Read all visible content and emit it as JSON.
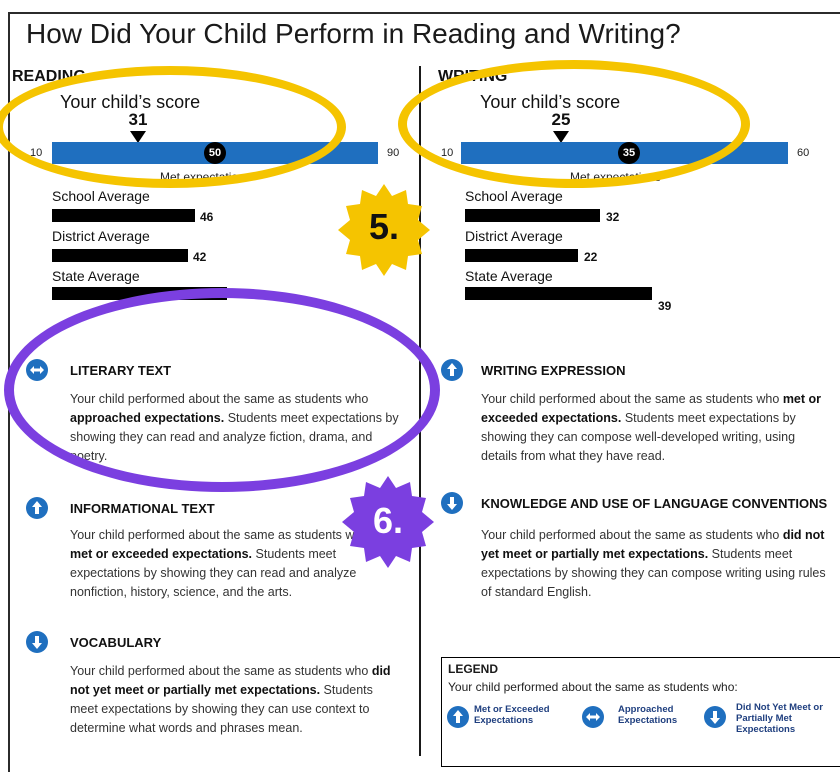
{
  "page": {
    "title": "How Did Your Child Perform in Reading and Writing?"
  },
  "reading": {
    "heading": "READING",
    "score_caption": "Your child’s score",
    "score": 31,
    "score_min": 10,
    "score_max": 90,
    "met_value": 50,
    "met_label": "Met expectations",
    "averages": [
      {
        "label": "School Average",
        "value": 46
      },
      {
        "label": "District Average",
        "value": 42
      },
      {
        "label": "State Average",
        "value": ""
      }
    ],
    "categories": [
      {
        "title": "LITERARY TEXT",
        "icon": "two-way-arrow-icon",
        "text_before": "Your child performed about the same as students who ",
        "text_bold": "approached expectations.",
        "text_after": " Students meet expectations by showing they can read and analyze fiction, drama, and poetry."
      },
      {
        "title": "INFORMATIONAL TEXT",
        "icon": "up-arrow-icon",
        "text_before": "Your child performed about the same as students who ",
        "text_bold": "met or exceeded expectations.",
        "text_after": " Students meet expectations by showing they can read and analyze nonfiction, history, science, and the arts."
      },
      {
        "title": "VOCABULARY",
        "icon": "down-arrow-icon",
        "text_before": "Your child performed about the same as students who ",
        "text_bold": "did not yet meet or partially met expectations.",
        "text_after": " Students meet expectations by showing they can use context to determine what words and phrases mean."
      }
    ]
  },
  "writing": {
    "heading": "WRITING",
    "score_caption": "Your child’s score",
    "score": 25,
    "score_min": 10,
    "score_max": 60,
    "met_value": 35,
    "met_label": "Met expectations",
    "averages": [
      {
        "label": "School Average",
        "value": 32
      },
      {
        "label": "District Average",
        "value": 22
      },
      {
        "label": "State Average",
        "value": 39
      }
    ],
    "categories": [
      {
        "title": "WRITING EXPRESSION",
        "icon": "up-arrow-icon",
        "text_before": "Your child performed about the same as students who ",
        "text_bold": "met or exceeded expectations.",
        "text_after": " Students meet expectations by showing they can compose well-developed writing, using details from what they have read."
      },
      {
        "title": "KNOWLEDGE AND USE OF LANGUAGE CONVENTIONS",
        "icon": "down-arrow-icon",
        "text_before": "Your child performed about the same as students who ",
        "text_bold": "did not yet meet or partially met expectations.",
        "text_after": " Students meet expectations by showing they can compose writing using rules of standard English."
      }
    ]
  },
  "legend": {
    "title": "LEGEND",
    "description": "Your child performed about the same as students who:",
    "items": [
      {
        "label": "Met or Exceeded Expectations",
        "icon": "up-arrow-icon"
      },
      {
        "label": "Approached Expectations",
        "icon": "two-way-arrow-icon"
      },
      {
        "label": "Did Not Yet Meet or Partially Met Expectations",
        "icon": "down-arrow-icon"
      }
    ]
  },
  "annotations": {
    "marker_5": "5.",
    "marker_6": "6.",
    "colors": {
      "yellow": "#f5c400",
      "purple": "#7b3fe0",
      "bar_blue": "#1f6fbf"
    }
  }
}
